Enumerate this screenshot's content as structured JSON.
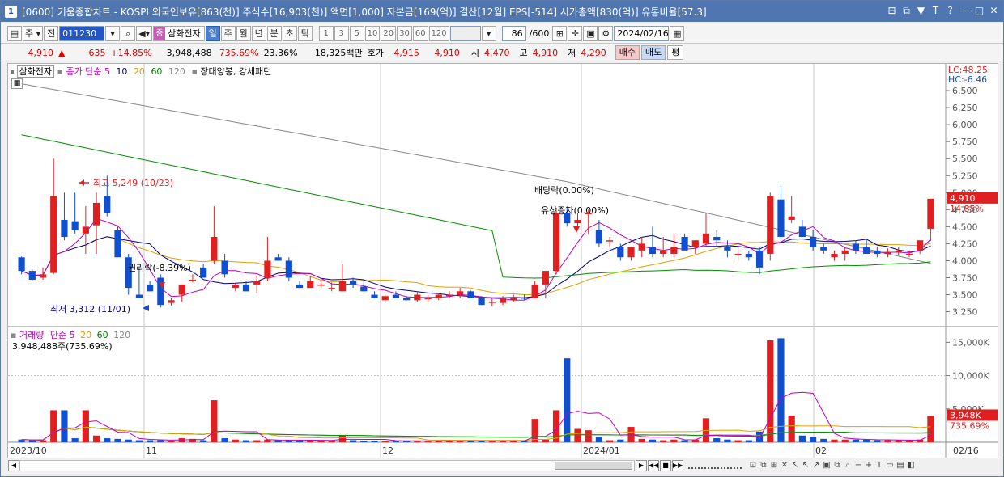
{
  "window": {
    "icon": "1",
    "title": "[0600] 키움종합차트 - KOSPI 외국인보유[863(천)] 주식수[16,903(천)] 액면[1,000] 자본금[169(억)] 결산[12월] EPS[-514] 시가총액[830(억)] 유통비율[57.3]",
    "controls": [
      "⊟",
      "⧉",
      "▼",
      "T",
      "?",
      "—",
      "□",
      "✕"
    ]
  },
  "toolbar": {
    "period_select": "주",
    "prev_label": "전",
    "code": "011230",
    "stock_name": "삼화전자",
    "name_marker": "증",
    "periods": [
      "일",
      "주",
      "월",
      "년",
      "분",
      "초",
      "틱"
    ],
    "selected_period": "일",
    "intervals": [
      "1",
      "3",
      "5",
      "10",
      "20",
      "30",
      "60",
      "120"
    ],
    "count": "86",
    "count_total": "/600",
    "date": "2024/02/16"
  },
  "quote": {
    "price": "4,910",
    "change_arrow": "▲",
    "change": "635",
    "change_pct": "+14.85%",
    "volume": "3,948,488",
    "vol_ratio": "735.69%",
    "turnover": "23.36%",
    "amount": "18,325백만",
    "hoga_label": "호가",
    "ask": "4,915",
    "bid": "4,910",
    "open_label": "시",
    "open": "4,470",
    "high_label": "고",
    "high": "4,910",
    "low_label": "저",
    "low": "4,290",
    "buy": "매수",
    "sell": "매도",
    "avg": "평"
  },
  "price_legend": {
    "name": "삼화전자",
    "ma_label": "종가 단순",
    "ma": [
      "5",
      "10",
      "20",
      "60",
      "120"
    ],
    "pattern": "장대양봉, 강세패턴"
  },
  "volume_legend": {
    "label": "거래량",
    "ma_label": "단순",
    "ma": [
      "5",
      "20",
      "60",
      "120"
    ],
    "value": "3,948,488주(735.69%)"
  },
  "side_info": {
    "lc": "LC:48.25",
    "hc": "HC:-6.46",
    "last_price": "4,910",
    "last_pct": "14.85%",
    "last_vol": "3,948K",
    "last_vol_pct": "735.69%"
  },
  "annotations": {
    "high": "최고 5,249 (10/23)",
    "low": "최저 3,312 (11/01)",
    "rights": "권리락(-8.39%)",
    "dividend": "배당락(0.00%)",
    "bonus": "유상증자(0.00%)"
  },
  "chart_data": [
    {
      "type": "candlestick",
      "y_ticks": [
        6500,
        6250,
        6000,
        5750,
        5500,
        5250,
        5000,
        4750,
        4500,
        4250,
        4000,
        3750,
        3500,
        3250
      ],
      "ylim": [
        3150,
        6750
      ],
      "x_labels": [
        "2023/10",
        "11",
        "12",
        "2024/01",
        "02",
        "02/16"
      ],
      "ohlc": [
        [
          4050,
          4060,
          3800,
          3850
        ],
        [
          3850,
          3870,
          3700,
          3720
        ],
        [
          3750,
          3900,
          3720,
          3800
        ],
        [
          3820,
          5500,
          3800,
          4950
        ],
        [
          4600,
          5000,
          4300,
          4350
        ],
        [
          4580,
          5000,
          4400,
          4450
        ],
        [
          4400,
          4800,
          4100,
          4500
        ],
        [
          4520,
          5000,
          4100,
          4850
        ],
        [
          4950,
          5249,
          4650,
          4700
        ],
        [
          4450,
          4500,
          4050,
          4050
        ],
        [
          4050,
          4100,
          3500,
          3600
        ],
        [
          3500,
          3900,
          3450,
          3450
        ],
        [
          3650,
          3700,
          3550,
          3550
        ],
        [
          3750,
          3800,
          3312,
          3350
        ],
        [
          3380,
          3450,
          3340,
          3420
        ],
        [
          3500,
          3600,
          3400,
          3650
        ],
        [
          3700,
          3800,
          3680,
          3720
        ],
        [
          3900,
          3950,
          3750,
          3750
        ],
        [
          4000,
          4800,
          3950,
          4350
        ],
        [
          4000,
          4100,
          3750,
          3800
        ],
        [
          3600,
          3680,
          3550,
          3650
        ],
        [
          3650,
          3700,
          3550,
          3550
        ],
        [
          3650,
          3780,
          3520,
          3700
        ],
        [
          3750,
          4350,
          3700,
          4000
        ],
        [
          4050,
          4100,
          4000,
          4000
        ],
        [
          4000,
          4050,
          3700,
          3750
        ],
        [
          3650,
          3700,
          3600,
          3600
        ],
        [
          3600,
          3780,
          3600,
          3700
        ],
        [
          3650,
          3700,
          3600,
          3650
        ],
        [
          3600,
          3680,
          3550,
          3600
        ],
        [
          3550,
          3950,
          3550,
          3700
        ],
        [
          3700,
          3750,
          3600,
          3650
        ],
        [
          3620,
          3700,
          3550,
          3550
        ],
        [
          3500,
          3550,
          3450,
          3450
        ],
        [
          3420,
          3500,
          3400,
          3480
        ],
        [
          3500,
          3550,
          3450,
          3450
        ],
        [
          3450,
          3480,
          3420,
          3420
        ],
        [
          3420,
          3550,
          3400,
          3500
        ],
        [
          3450,
          3500,
          3400,
          3450
        ],
        [
          3450,
          3520,
          3420,
          3500
        ],
        [
          3480,
          3550,
          3450,
          3500
        ],
        [
          3500,
          3600,
          3450,
          3550
        ],
        [
          3550,
          3560,
          3450,
          3450
        ],
        [
          3450,
          3480,
          3350,
          3350
        ],
        [
          3380,
          3450,
          3330,
          3400
        ],
        [
          3380,
          3480,
          3350,
          3450
        ],
        [
          3420,
          3500,
          3400,
          3450
        ],
        [
          3460,
          3500,
          3420,
          3450
        ],
        [
          3450,
          3700,
          3450,
          3650
        ],
        [
          3650,
          3750,
          3450,
          3850
        ],
        [
          3850,
          4750,
          3800,
          4700
        ],
        [
          4700,
          4800,
          4500,
          4550
        ],
        [
          4550,
          4700,
          4450,
          4600
        ],
        [
          4700,
          4750,
          4400,
          4700
        ],
        [
          4450,
          4600,
          4200,
          4250
        ],
        [
          4300,
          4350,
          4200,
          4300
        ],
        [
          4200,
          4250,
          4000,
          4050
        ],
        [
          4050,
          4200,
          4000,
          4200
        ],
        [
          4150,
          4350,
          4050,
          4250
        ],
        [
          4200,
          4500,
          4050,
          4100
        ],
        [
          4100,
          4350,
          4050,
          4150
        ],
        [
          4100,
          4400,
          4050,
          4200
        ],
        [
          4350,
          4400,
          4150,
          4150
        ],
        [
          4200,
          4300,
          4100,
          4300
        ],
        [
          4250,
          4700,
          4200,
          4400
        ],
        [
          4350,
          4450,
          4200,
          4300
        ],
        [
          4200,
          4300,
          4050,
          4150
        ],
        [
          4100,
          4200,
          4000,
          4100
        ],
        [
          4100,
          4150,
          4000,
          4050
        ],
        [
          4150,
          4200,
          3800,
          3900
        ],
        [
          4100,
          5000,
          4000,
          4950
        ],
        [
          4900,
          5100,
          4300,
          4350
        ],
        [
          4600,
          4950,
          4550,
          4650
        ],
        [
          4500,
          4600,
          4350,
          4350
        ],
        [
          4350,
          4450,
          4150,
          4200
        ],
        [
          4200,
          4250,
          4100,
          4150
        ],
        [
          4050,
          4150,
          4000,
          4100
        ],
        [
          4100,
          4200,
          4000,
          4150
        ],
        [
          4250,
          4300,
          4100,
          4150
        ],
        [
          4200,
          4300,
          4150,
          4100
        ],
        [
          4150,
          4200,
          4050,
          4100
        ],
        [
          4100,
          4180,
          4050,
          4120
        ],
        [
          4120,
          4200,
          4080,
          4150
        ],
        [
          4100,
          4150,
          4050,
          4100
        ],
        [
          4150,
          4250,
          4100,
          4300
        ],
        [
          4470,
          4910,
          4290,
          4910
        ]
      ]
    },
    {
      "type": "bar",
      "y_ticks": [
        "15,000K",
        "10,000K",
        "5,000K"
      ],
      "ylim": [
        0,
        16500
      ],
      "values": [
        400,
        300,
        300,
        4800,
        4800,
        600,
        4800,
        1000,
        600,
        500,
        400,
        300,
        300,
        300,
        250,
        600,
        500,
        300,
        6300,
        600,
        400,
        300,
        300,
        400,
        300,
        300,
        300,
        300,
        250,
        250,
        1100,
        300,
        250,
        250,
        200,
        200,
        200,
        200,
        200,
        200,
        200,
        200,
        200,
        200,
        200,
        200,
        200,
        200,
        3500,
        400,
        4800,
        12600,
        2000,
        1800,
        800,
        300,
        400,
        2300,
        500,
        400,
        300,
        400,
        300,
        400,
        3600,
        600,
        400,
        300,
        300,
        1600,
        15300,
        15600,
        4000,
        1000,
        800,
        500,
        400,
        400,
        400,
        400,
        300,
        300,
        300,
        300,
        400,
        3948
      ]
    }
  ]
}
